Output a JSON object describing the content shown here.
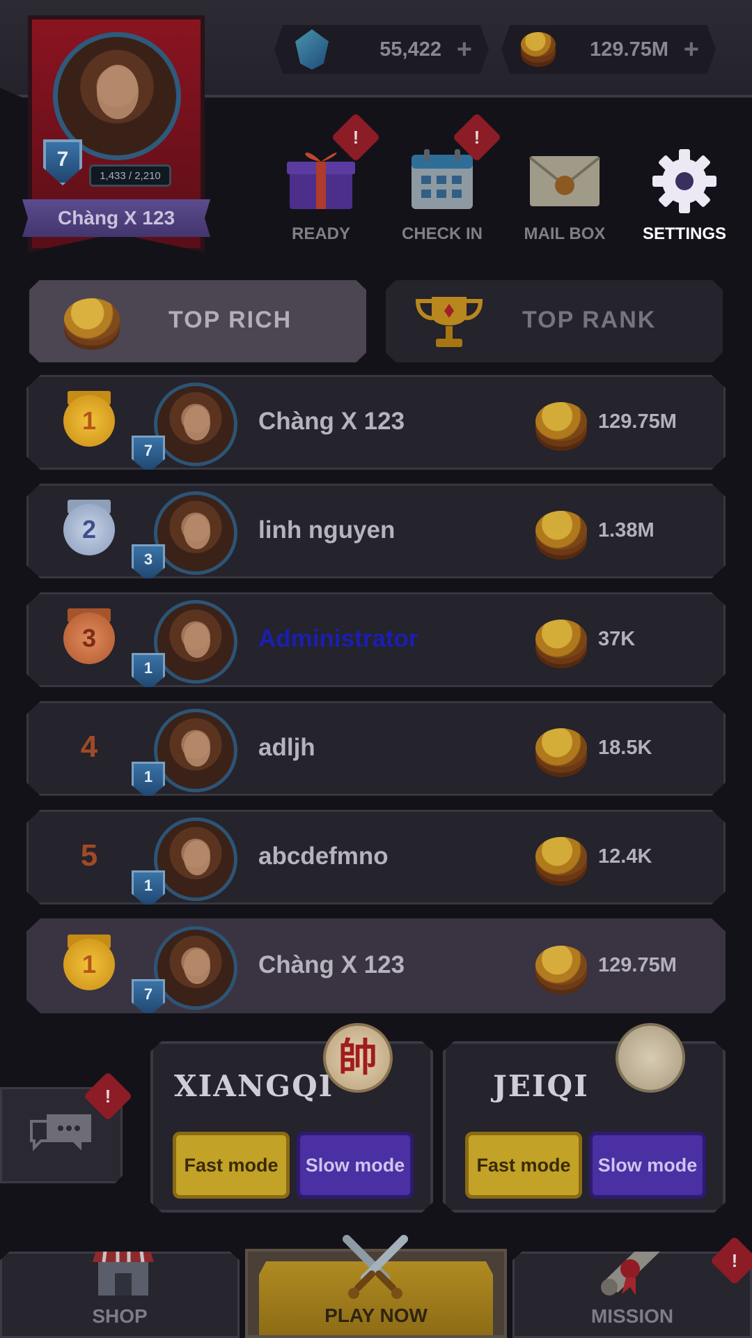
{
  "currency": {
    "gems": "55,422",
    "gems_plus": "+",
    "gold": "129.75M",
    "gold_plus": "+"
  },
  "profile": {
    "level": "7",
    "xp": "1,433 / 2,210",
    "name": "Chàng X 123"
  },
  "quick_actions": [
    {
      "label": "READY",
      "icon": "gift-icon",
      "badge": "!"
    },
    {
      "label": "CHECK IN",
      "icon": "calendar-icon",
      "badge": "!"
    },
    {
      "label": "MAIL BOX",
      "icon": "envelope-icon"
    },
    {
      "label": "SETTINGS",
      "icon": "gear-icon"
    }
  ],
  "tabs": {
    "top_rich": "TOP RICH",
    "top_rank": "TOP RANK"
  },
  "leaderboard": [
    {
      "rank": "1",
      "medal": "gold",
      "level": "7",
      "name": "Chàng X 123",
      "amount": "129.75M"
    },
    {
      "rank": "2",
      "medal": "silver",
      "level": "3",
      "name": "linh nguyen",
      "amount": "1.38M"
    },
    {
      "rank": "3",
      "medal": "bronze",
      "level": "1",
      "name": "Administrator",
      "amount": "37K"
    },
    {
      "rank": "4",
      "level": "1",
      "name": "adljh",
      "amount": "18.5K"
    },
    {
      "rank": "5",
      "level": "1",
      "name": "abcdefmno",
      "amount": "12.4K"
    }
  ],
  "self_row": {
    "rank": "1",
    "medal": "gold",
    "level": "7",
    "name": "Chàng X 123",
    "amount": "129.75M"
  },
  "games": [
    {
      "title": "XIANGQI",
      "piece": "帥",
      "fast": "Fast mode",
      "slow": "Slow mode"
    },
    {
      "title": "JEIQI",
      "fast": "Fast mode",
      "slow": "Slow mode"
    }
  ],
  "chat": {
    "badge": "!"
  },
  "nav": {
    "shop": "SHOP",
    "play": "PLAY NOW",
    "mission": "MISSION",
    "mission_badge": "!"
  },
  "colors": {
    "background": "#141219",
    "gold_medal": "#e0a81c",
    "silver_medal": "#9ab0d0",
    "bronze_medal": "#c06a3c",
    "admin_name": "#1a1fb0",
    "fast_button": "#c2a227",
    "slow_button": "#4a30a2"
  }
}
